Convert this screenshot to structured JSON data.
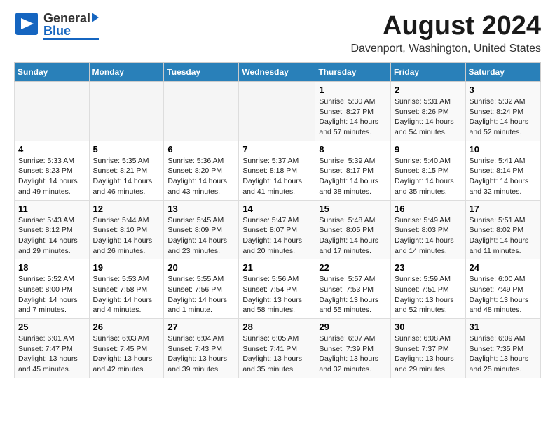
{
  "header": {
    "logo_general": "General",
    "logo_blue": "Blue",
    "title": "August 2024",
    "subtitle": "Davenport, Washington, United States"
  },
  "calendar": {
    "days_of_week": [
      "Sunday",
      "Monday",
      "Tuesday",
      "Wednesday",
      "Thursday",
      "Friday",
      "Saturday"
    ],
    "weeks": [
      [
        {
          "day": "",
          "content": ""
        },
        {
          "day": "",
          "content": ""
        },
        {
          "day": "",
          "content": ""
        },
        {
          "day": "",
          "content": ""
        },
        {
          "day": "1",
          "content": "Sunrise: 5:30 AM\nSunset: 8:27 PM\nDaylight: 14 hours\nand 57 minutes."
        },
        {
          "day": "2",
          "content": "Sunrise: 5:31 AM\nSunset: 8:26 PM\nDaylight: 14 hours\nand 54 minutes."
        },
        {
          "day": "3",
          "content": "Sunrise: 5:32 AM\nSunset: 8:24 PM\nDaylight: 14 hours\nand 52 minutes."
        }
      ],
      [
        {
          "day": "4",
          "content": "Sunrise: 5:33 AM\nSunset: 8:23 PM\nDaylight: 14 hours\nand 49 minutes."
        },
        {
          "day": "5",
          "content": "Sunrise: 5:35 AM\nSunset: 8:21 PM\nDaylight: 14 hours\nand 46 minutes."
        },
        {
          "day": "6",
          "content": "Sunrise: 5:36 AM\nSunset: 8:20 PM\nDaylight: 14 hours\nand 43 minutes."
        },
        {
          "day": "7",
          "content": "Sunrise: 5:37 AM\nSunset: 8:18 PM\nDaylight: 14 hours\nand 41 minutes."
        },
        {
          "day": "8",
          "content": "Sunrise: 5:39 AM\nSunset: 8:17 PM\nDaylight: 14 hours\nand 38 minutes."
        },
        {
          "day": "9",
          "content": "Sunrise: 5:40 AM\nSunset: 8:15 PM\nDaylight: 14 hours\nand 35 minutes."
        },
        {
          "day": "10",
          "content": "Sunrise: 5:41 AM\nSunset: 8:14 PM\nDaylight: 14 hours\nand 32 minutes."
        }
      ],
      [
        {
          "day": "11",
          "content": "Sunrise: 5:43 AM\nSunset: 8:12 PM\nDaylight: 14 hours\nand 29 minutes."
        },
        {
          "day": "12",
          "content": "Sunrise: 5:44 AM\nSunset: 8:10 PM\nDaylight: 14 hours\nand 26 minutes."
        },
        {
          "day": "13",
          "content": "Sunrise: 5:45 AM\nSunset: 8:09 PM\nDaylight: 14 hours\nand 23 minutes."
        },
        {
          "day": "14",
          "content": "Sunrise: 5:47 AM\nSunset: 8:07 PM\nDaylight: 14 hours\nand 20 minutes."
        },
        {
          "day": "15",
          "content": "Sunrise: 5:48 AM\nSunset: 8:05 PM\nDaylight: 14 hours\nand 17 minutes."
        },
        {
          "day": "16",
          "content": "Sunrise: 5:49 AM\nSunset: 8:03 PM\nDaylight: 14 hours\nand 14 minutes."
        },
        {
          "day": "17",
          "content": "Sunrise: 5:51 AM\nSunset: 8:02 PM\nDaylight: 14 hours\nand 11 minutes."
        }
      ],
      [
        {
          "day": "18",
          "content": "Sunrise: 5:52 AM\nSunset: 8:00 PM\nDaylight: 14 hours\nand 7 minutes."
        },
        {
          "day": "19",
          "content": "Sunrise: 5:53 AM\nSunset: 7:58 PM\nDaylight: 14 hours\nand 4 minutes."
        },
        {
          "day": "20",
          "content": "Sunrise: 5:55 AM\nSunset: 7:56 PM\nDaylight: 14 hours and 1 minute."
        },
        {
          "day": "21",
          "content": "Sunrise: 5:56 AM\nSunset: 7:54 PM\nDaylight: 13 hours\nand 58 minutes."
        },
        {
          "day": "22",
          "content": "Sunrise: 5:57 AM\nSunset: 7:53 PM\nDaylight: 13 hours\nand 55 minutes."
        },
        {
          "day": "23",
          "content": "Sunrise: 5:59 AM\nSunset: 7:51 PM\nDaylight: 13 hours\nand 52 minutes."
        },
        {
          "day": "24",
          "content": "Sunrise: 6:00 AM\nSunset: 7:49 PM\nDaylight: 13 hours\nand 48 minutes."
        }
      ],
      [
        {
          "day": "25",
          "content": "Sunrise: 6:01 AM\nSunset: 7:47 PM\nDaylight: 13 hours\nand 45 minutes."
        },
        {
          "day": "26",
          "content": "Sunrise: 6:03 AM\nSunset: 7:45 PM\nDaylight: 13 hours\nand 42 minutes."
        },
        {
          "day": "27",
          "content": "Sunrise: 6:04 AM\nSunset: 7:43 PM\nDaylight: 13 hours\nand 39 minutes."
        },
        {
          "day": "28",
          "content": "Sunrise: 6:05 AM\nSunset: 7:41 PM\nDaylight: 13 hours\nand 35 minutes."
        },
        {
          "day": "29",
          "content": "Sunrise: 6:07 AM\nSunset: 7:39 PM\nDaylight: 13 hours\nand 32 minutes."
        },
        {
          "day": "30",
          "content": "Sunrise: 6:08 AM\nSunset: 7:37 PM\nDaylight: 13 hours\nand 29 minutes."
        },
        {
          "day": "31",
          "content": "Sunrise: 6:09 AM\nSunset: 7:35 PM\nDaylight: 13 hours\nand 25 minutes."
        }
      ]
    ]
  }
}
